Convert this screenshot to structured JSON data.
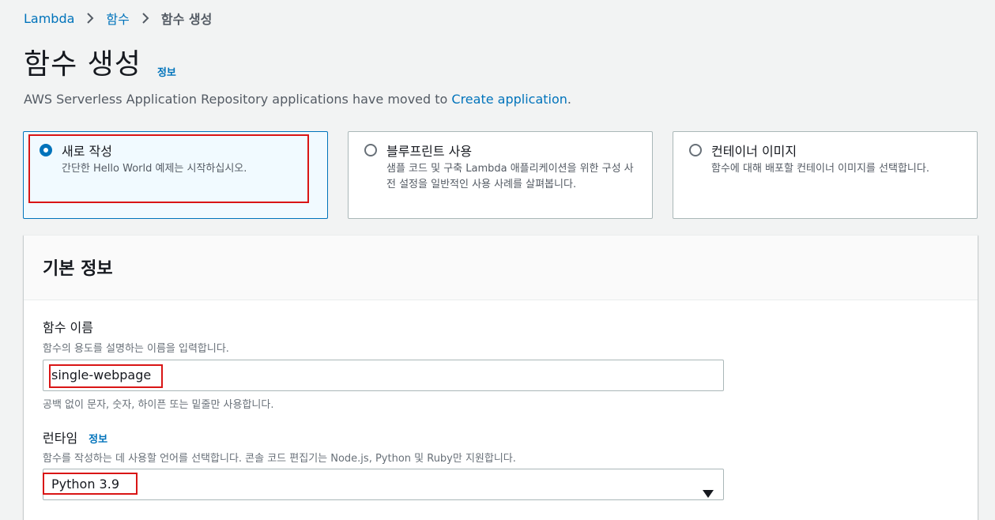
{
  "breadcrumb": {
    "root": "Lambda",
    "parent": "함수",
    "current": "함수 생성"
  },
  "header": {
    "title": "함수 생성",
    "info_link": "정보",
    "subtitle_prefix": "AWS Serverless Application Repository applications have moved to ",
    "subtitle_link": "Create application",
    "subtitle_suffix": "."
  },
  "options": [
    {
      "title": "새로 작성",
      "description": "간단한 Hello World 예제는 시작하십시오.",
      "selected": true
    },
    {
      "title": "블루프린트 사용",
      "description": "샘플 코드 및 구축 Lambda 애플리케이션을 위한 구성 사전 설정을 일반적인 사용 사례를 살펴봅니다.",
      "selected": false
    },
    {
      "title": "컨테이너 이미지",
      "description": "함수에 대해 배포할 컨테이너 이미지를 선택합니다.",
      "selected": false
    }
  ],
  "basic_info": {
    "title": "기본 정보",
    "function_name": {
      "label": "함수 이름",
      "description": "함수의 용도를 설명하는 이름을 입력합니다.",
      "value": "single-webpage",
      "constraint": "공백 없이 문자, 숫자, 하이픈 또는 밑줄만 사용합니다."
    },
    "runtime": {
      "label": "런타임",
      "info_link": "정보",
      "description": "함수를 작성하는 데 사용할 언어를 선택합니다. 콘솔 코드 편집기는 Node.js, Python 및 Ruby만 지원합니다.",
      "value": "Python 3.9"
    }
  },
  "colors": {
    "link": "#0073bb",
    "highlight": "#d91515",
    "selected_bg": "#f1faff",
    "page_bg": "#f2f3f3"
  }
}
